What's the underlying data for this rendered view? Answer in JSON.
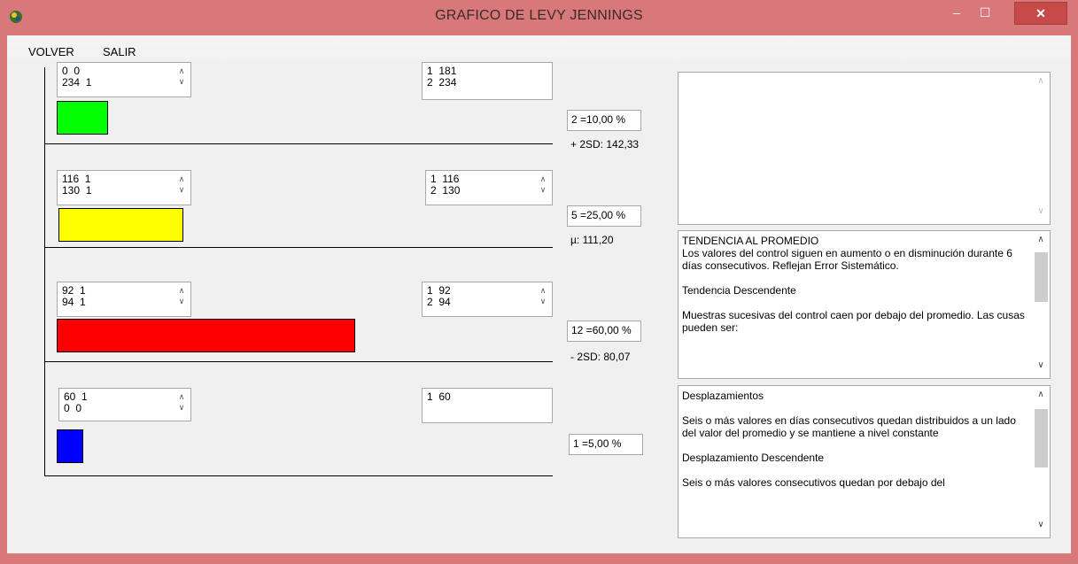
{
  "window": {
    "title": "GRAFICO DE LEVY JENNINGS",
    "min_glyph": "‒",
    "max_glyph": "☐",
    "close_glyph": "✕"
  },
  "menu": {
    "volver": "VOLVER",
    "salir": "SALIR"
  },
  "spinner": {
    "up": "∧",
    "down": "∨"
  },
  "levels": [
    {
      "left_list": [
        "0  0",
        "234  1"
      ],
      "right_list": [
        "1  181",
        "2  234"
      ],
      "color": "#00ff00",
      "percent": "2 =10,00 %",
      "line_label": "+ 2SD: 142,33"
    },
    {
      "left_list": [
        "116  1",
        "130  1"
      ],
      "right_list": [
        "1  116",
        "2  130"
      ],
      "color": "#ffff00",
      "percent": "5 =25,00 %",
      "line_label": "µ: 111,20"
    },
    {
      "left_list": [
        "92  1",
        "94  1"
      ],
      "right_list": [
        "1  92",
        "2  94"
      ],
      "color": "#ff0000",
      "percent": "12 =60,00 %",
      "line_label": "- 2SD: 80,07"
    },
    {
      "left_list": [
        "60  1",
        "0  0"
      ],
      "right_list": [
        "1  60"
      ],
      "color": "#0000ff",
      "percent": "1 =5,00 %",
      "line_label": ""
    }
  ],
  "memo_trend": {
    "title": "TENDENCIA AL PROMEDIO",
    "desc": "Los valores del control siguen en aumento o en disminución durante 6 días consecutivos. Reflejan Error Sistemático.",
    "subtitle": "Tendencia Descendente",
    "desc2": "Muestras sucesivas del control caen por debajo del promedio. Las cusas pueden ser:"
  },
  "memo_shift": {
    "title": "Desplazamientos",
    "desc": "Seis o más valores en días consecutivos quedan distribuidos a un lado del valor del promedio y se mantiene a nivel constante",
    "subtitle": "Desplazamiento Descendente",
    "desc2": "Seis o más valores consecutivos quedan por debajo del"
  }
}
